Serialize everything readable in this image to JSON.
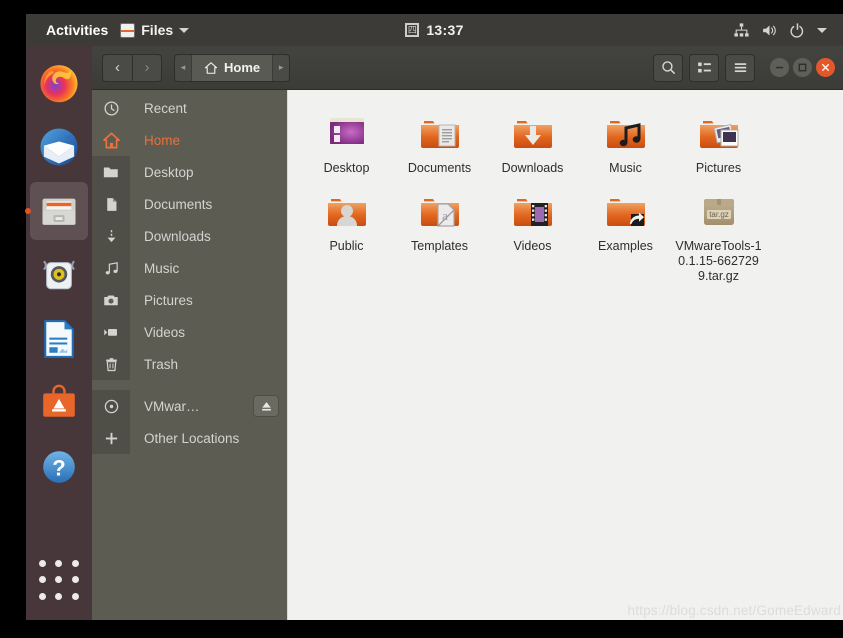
{
  "topbar": {
    "activities": "Activities",
    "app_name": "Files",
    "app_icon": "files-app-icon",
    "app_menu_caret": "chevron-down-icon",
    "clock": "13:37",
    "calendar_glyph": "四",
    "calendar_icon": "calendar-icon",
    "tray": [
      {
        "name": "network-icon"
      },
      {
        "name": "volume-icon"
      },
      {
        "name": "power-icon"
      },
      {
        "name": "chevron-down-icon"
      }
    ]
  },
  "dock": {
    "items": [
      {
        "name": "firefox",
        "label": "Firefox",
        "running": false
      },
      {
        "name": "thunderbird",
        "label": "Thunderbird",
        "running": false
      },
      {
        "name": "files",
        "label": "Files",
        "running": true
      },
      {
        "name": "rhythmbox",
        "label": "Rhythmbox",
        "running": false
      },
      {
        "name": "libreoffice-writer",
        "label": "LibreOffice Writer",
        "running": false
      },
      {
        "name": "ubuntu-software",
        "label": "Ubuntu Software",
        "running": false
      },
      {
        "name": "help",
        "label": "Help",
        "running": false
      }
    ],
    "show_applications": "show-applications-grid"
  },
  "window": {
    "headerbar": {
      "back": "‹",
      "forward": "›",
      "path_prev": "◂",
      "path_next": "▸",
      "breadcrumb": "Home",
      "breadcrumb_icon": "home-icon",
      "search_icon": "search-icon",
      "view_icon": "view-list-icon",
      "menu_icon": "hamburger-menu-icon",
      "minimize": "−",
      "maximize": "□",
      "close": "×"
    },
    "sidebar": {
      "items": [
        {
          "label": "Recent",
          "icon": "clock-icon",
          "active": false,
          "eject": false
        },
        {
          "label": "Home",
          "icon": "home-icon",
          "active": true,
          "eject": false
        },
        {
          "label": "Desktop",
          "icon": "folder-icon",
          "active": false,
          "eject": false
        },
        {
          "label": "Documents",
          "icon": "document-icon",
          "active": false,
          "eject": false
        },
        {
          "label": "Downloads",
          "icon": "download-icon",
          "active": false,
          "eject": false
        },
        {
          "label": "Music",
          "icon": "music-icon",
          "active": false,
          "eject": false
        },
        {
          "label": "Pictures",
          "icon": "camera-icon",
          "active": false,
          "eject": false
        },
        {
          "label": "Videos",
          "icon": "video-icon",
          "active": false,
          "eject": false
        },
        {
          "label": "Trash",
          "icon": "trash-icon",
          "active": false,
          "eject": false
        },
        {
          "label": "VMwar…",
          "icon": "disc-icon",
          "active": false,
          "eject": true
        },
        {
          "label": "Other Locations",
          "icon": "plus-icon",
          "active": false,
          "eject": false
        }
      ],
      "eject_icon": "eject-icon"
    },
    "files": [
      {
        "name": "Desktop",
        "icon": "desktop-folder-icon"
      },
      {
        "name": "Documents",
        "icon": "documents-folder-icon"
      },
      {
        "name": "Downloads",
        "icon": "downloads-folder-icon"
      },
      {
        "name": "Music",
        "icon": "music-folder-icon"
      },
      {
        "name": "Pictures",
        "icon": "pictures-folder-icon"
      },
      {
        "name": "Public",
        "icon": "public-folder-icon"
      },
      {
        "name": "Templates",
        "icon": "templates-folder-icon"
      },
      {
        "name": "Videos",
        "icon": "videos-folder-icon"
      },
      {
        "name": "Examples",
        "icon": "examples-folder-link-icon"
      },
      {
        "name": "VMwareTools-10.1.15-6627299.tar.gz",
        "icon": "archive-targz-icon"
      }
    ]
  },
  "watermark": "https://blog.csdn.net/GomeEdward"
}
